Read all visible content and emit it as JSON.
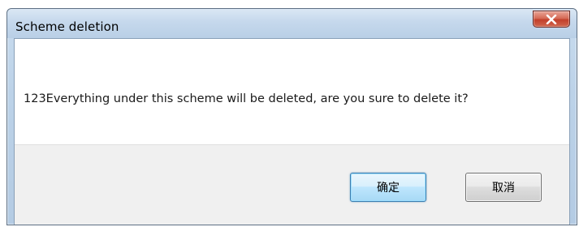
{
  "window": {
    "title": "Scheme deletion"
  },
  "titlebar": {
    "close_icon": "close-icon",
    "close_color": "#c7402b"
  },
  "dialog": {
    "message": "123Everything under this scheme will be deleted, are you sure to delete it?"
  },
  "buttons": {
    "ok_label": "确定",
    "cancel_label": "取消"
  }
}
